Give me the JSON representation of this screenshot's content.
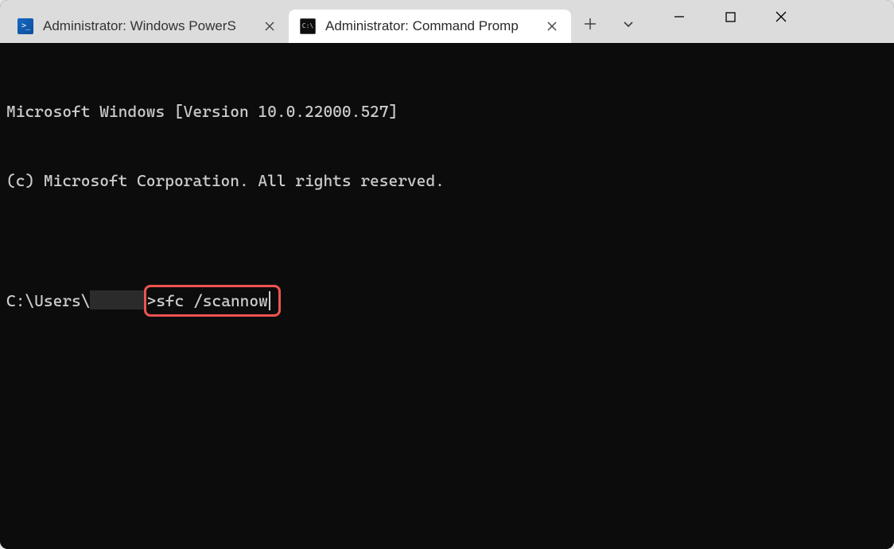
{
  "tabs": [
    {
      "title": "Administrator: Windows PowerS",
      "active": false,
      "icon": "powershell-icon"
    },
    {
      "title": "Administrator: Command Promp",
      "active": true,
      "icon": "cmd-icon"
    }
  ],
  "terminal": {
    "version_line": "Microsoft Windows [Version 10.0.22000.527]",
    "copyright_line": "(c) Microsoft Corporation. All rights reserved.",
    "prompt_prefix": "C:\\Users\\",
    "prompt_gt": ">",
    "typed_command": "sfc /scannow"
  },
  "colors": {
    "highlight_border": "#ef5350",
    "terminal_bg": "#0c0c0c",
    "terminal_fg": "#cccccc",
    "titlebar_bg": "#dcdcdc",
    "active_tab_bg": "#ffffff"
  }
}
